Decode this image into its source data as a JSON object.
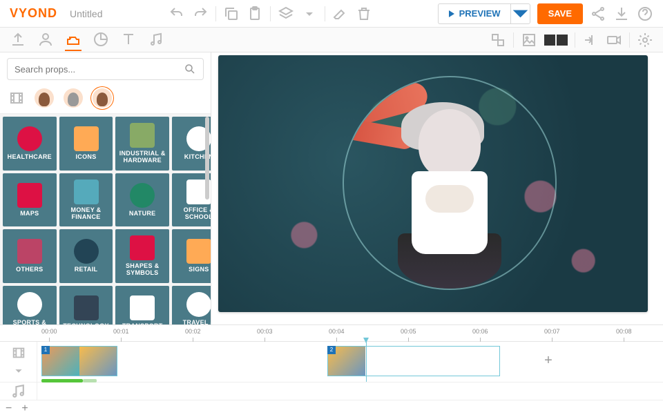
{
  "header": {
    "logo": "VYOND",
    "title": "Untitled",
    "preview": "PREVIEW",
    "save": "SAVE"
  },
  "search": {
    "placeholder": "Search props..."
  },
  "categories": [
    {
      "label": "HEALTHCARE"
    },
    {
      "label": "ICONS"
    },
    {
      "label": "INDUSTRIAL & HARDWARE"
    },
    {
      "label": "KITCHEN"
    },
    {
      "label": "MAPS"
    },
    {
      "label": "MONEY & FINANCE"
    },
    {
      "label": "NATURE"
    },
    {
      "label": "OFFICE & SCHOOL"
    },
    {
      "label": "OTHERS"
    },
    {
      "label": "RETAIL"
    },
    {
      "label": "SHAPES & SYMBOLS"
    },
    {
      "label": "SIGNS"
    },
    {
      "label": "SPORTS & FITNESS"
    },
    {
      "label": "TECHNOLOGY"
    },
    {
      "label": "TRANSPORT"
    },
    {
      "label": "TRAVEL & TOURISM"
    }
  ],
  "timeline": {
    "ticks": [
      "00:00",
      "00:01",
      "00:02",
      "00:03",
      "00:04",
      "00:05",
      "00:06",
      "00:07",
      "00:08"
    ],
    "clips": [
      {
        "num": "1"
      },
      {
        "num": "2"
      }
    ],
    "add": "+",
    "zoom_out": "−",
    "zoom_in": "+"
  }
}
